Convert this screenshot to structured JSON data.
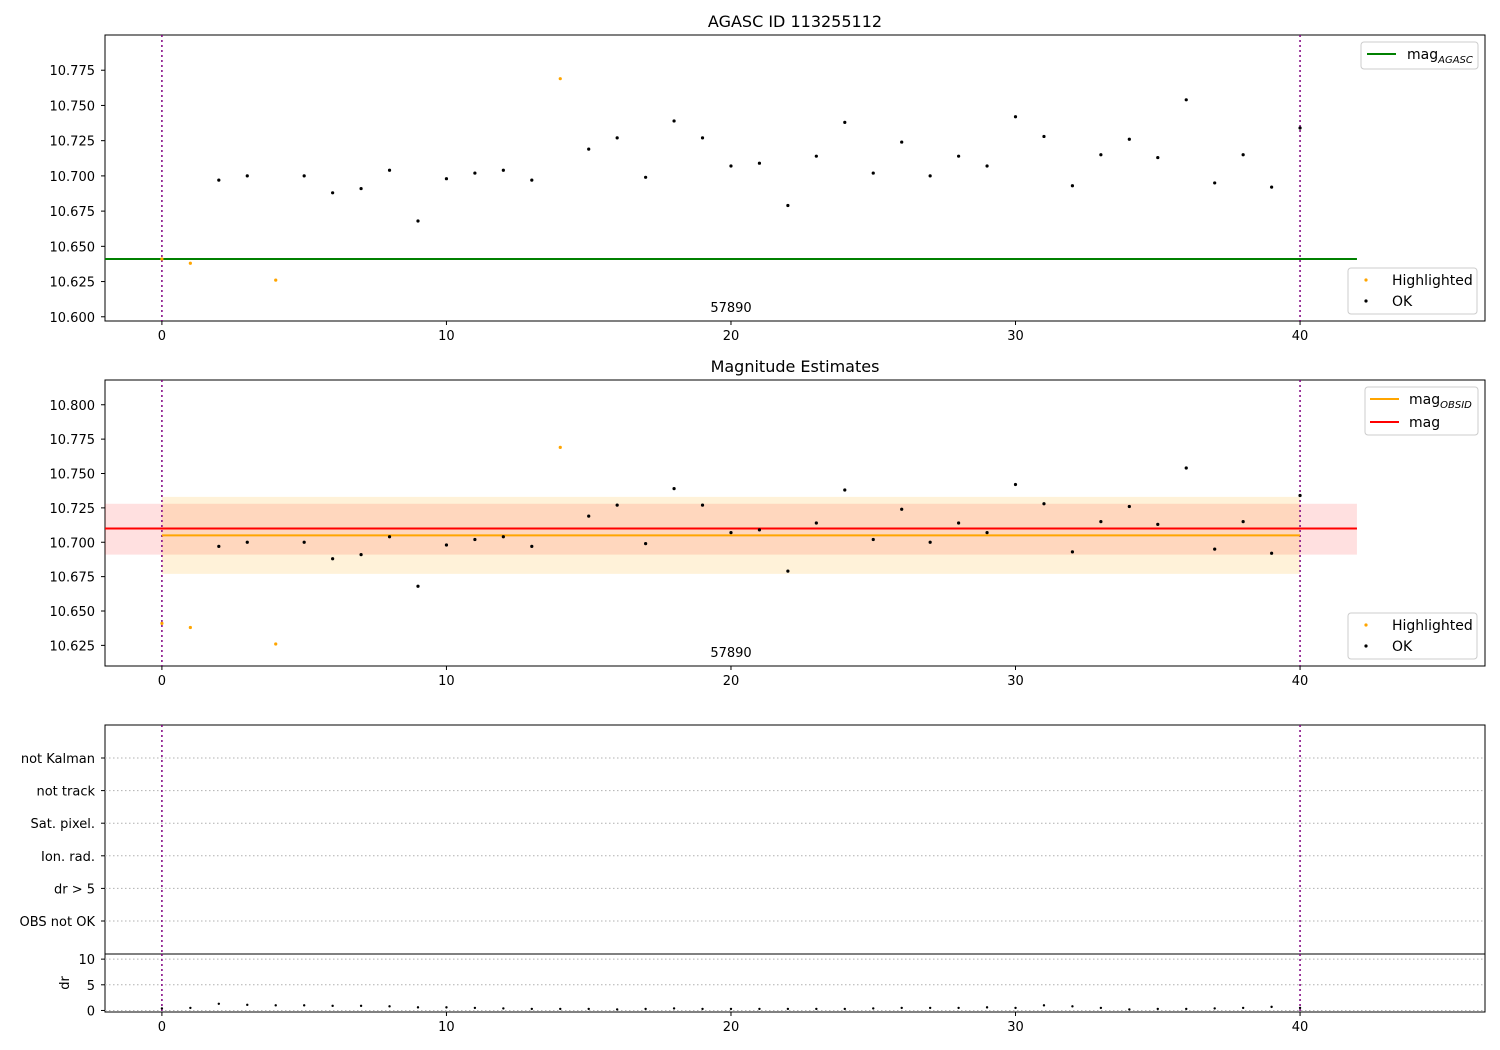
{
  "chart_data": [
    {
      "type": "scatter",
      "title": "AGASC ID 113255112",
      "annotation": "57890",
      "xlim": [
        -2,
        46.5
      ],
      "ylim": [
        10.597,
        10.8
      ],
      "xticks": [
        "0",
        "10",
        "20",
        "30",
        "40"
      ],
      "xtick_values": [
        0,
        10,
        20,
        30,
        40
      ],
      "yticks": [
        "10.600",
        "10.625",
        "10.650",
        "10.675",
        "10.700",
        "10.725",
        "10.750",
        "10.775"
      ],
      "ytick_values": [
        10.6,
        10.625,
        10.65,
        10.675,
        10.7,
        10.725,
        10.75,
        10.775
      ],
      "vlines": [
        0,
        40
      ],
      "hline": {
        "name": "mag",
        "subscript": "AGASC",
        "value": 10.641,
        "x_range": [
          -2,
          42
        ],
        "color": "#008000"
      },
      "legend_lines": [
        {
          "name": "mag",
          "subscript": "AGASC",
          "color": "#008000"
        }
      ],
      "legend_points": [
        {
          "name": "Highlighted",
          "color": "#FFA500"
        },
        {
          "name": "OK",
          "color": "#000000"
        }
      ]
    },
    {
      "type": "scatter",
      "title": "Magnitude Estimates",
      "annotation": "57890",
      "xlim": [
        -2,
        46.5
      ],
      "ylim": [
        10.61,
        10.818
      ],
      "xticks": [
        "0",
        "10",
        "20",
        "30",
        "40"
      ],
      "xtick_values": [
        0,
        10,
        20,
        30,
        40
      ],
      "yticks": [
        "10.625",
        "10.650",
        "10.675",
        "10.700",
        "10.725",
        "10.750",
        "10.775",
        "10.800"
      ],
      "ytick_values": [
        10.625,
        10.65,
        10.675,
        10.7,
        10.725,
        10.75,
        10.775,
        10.8
      ],
      "vlines": [
        0,
        40
      ],
      "bands": [
        {
          "name": "mag",
          "color": "#ff0000",
          "opacity": 0.12,
          "x_range": [
            -2,
            42
          ],
          "y_range": [
            10.691,
            10.728
          ]
        },
        {
          "name": "mag_obsid",
          "color": "#FFA500",
          "opacity": 0.15,
          "x_range": [
            0,
            40
          ],
          "y_range": [
            10.677,
            10.733
          ]
        }
      ],
      "lines": [
        {
          "name": "mag",
          "subscript": "OBSID",
          "value": 10.705,
          "x_range": [
            0,
            40
          ],
          "color": "#FFA500"
        },
        {
          "name": "mag",
          "subscript": "",
          "value": 10.71,
          "x_range": [
            -2,
            42
          ],
          "color": "#ff0000"
        }
      ],
      "legend_lines": [
        {
          "name": "mag",
          "subscript": "OBSID",
          "color": "#FFA500"
        },
        {
          "name": "mag",
          "subscript": "",
          "color": "#ff0000"
        }
      ],
      "legend_points": [
        {
          "name": "Highlighted",
          "color": "#FFA500"
        },
        {
          "name": "OK",
          "color": "#000000"
        }
      ]
    },
    {
      "type": "scatter",
      "title": "",
      "xlim": [
        -2,
        46.5
      ],
      "categories": [
        "not Kalman",
        "not track",
        "Sat. pixel.",
        "Ion. rad.",
        "dr > 5",
        "OBS not OK"
      ],
      "vlines": [
        0,
        40
      ]
    },
    {
      "type": "scatter",
      "title": "",
      "ylabel": "dr",
      "xlim": [
        -2,
        46.5
      ],
      "ylim": [
        -0.3,
        11
      ],
      "xticks": [
        "0",
        "10",
        "20",
        "30",
        "40"
      ],
      "xtick_values": [
        0,
        10,
        20,
        30,
        40
      ],
      "yticks": [
        "0",
        "5",
        "10"
      ],
      "ytick_values": [
        0,
        5,
        10
      ],
      "vlines": [
        0,
        40
      ]
    }
  ],
  "series": {
    "x": [
      0,
      1,
      2,
      3,
      4,
      5,
      6,
      7,
      8,
      9,
      10,
      11,
      12,
      13,
      14,
      15,
      16,
      17,
      18,
      19,
      20,
      21,
      22,
      23,
      24,
      25,
      26,
      27,
      28,
      29,
      30,
      31,
      32,
      33,
      34,
      35,
      36,
      37,
      38,
      39,
      40
    ],
    "mag": [
      10.641,
      10.638,
      10.697,
      10.7,
      10.626,
      10.7,
      10.688,
      10.691,
      10.704,
      10.668,
      10.698,
      10.702,
      10.704,
      10.697,
      10.769,
      10.719,
      10.727,
      10.699,
      10.739,
      10.727,
      10.707,
      10.709,
      10.679,
      10.714,
      10.738,
      10.702,
      10.724,
      10.7,
      10.714,
      10.707,
      10.742,
      10.728,
      10.693,
      10.715,
      10.726,
      10.713,
      10.754,
      10.695,
      10.715,
      10.692,
      10.734
    ],
    "highlighted": [
      true,
      true,
      false,
      false,
      true,
      false,
      false,
      false,
      false,
      false,
      false,
      false,
      false,
      false,
      true,
      false,
      false,
      false,
      false,
      false,
      false,
      false,
      false,
      false,
      false,
      false,
      false,
      false,
      false,
      false,
      false,
      false,
      false,
      false,
      false,
      false,
      false,
      false,
      false,
      false,
      false
    ],
    "dr": [
      0.4,
      0.5,
      1.3,
      1.1,
      1.0,
      1.0,
      0.9,
      0.9,
      0.8,
      0.6,
      0.6,
      0.5,
      0.4,
      0.3,
      0.3,
      0.3,
      0.2,
      0.3,
      0.4,
      0.3,
      0.3,
      0.3,
      0.3,
      0.3,
      0.3,
      0.4,
      0.5,
      0.5,
      0.5,
      0.6,
      0.5,
      1.0,
      0.8,
      0.5,
      0.2,
      0.3,
      0.3,
      0.4,
      0.5,
      0.7,
      0.5
    ]
  }
}
